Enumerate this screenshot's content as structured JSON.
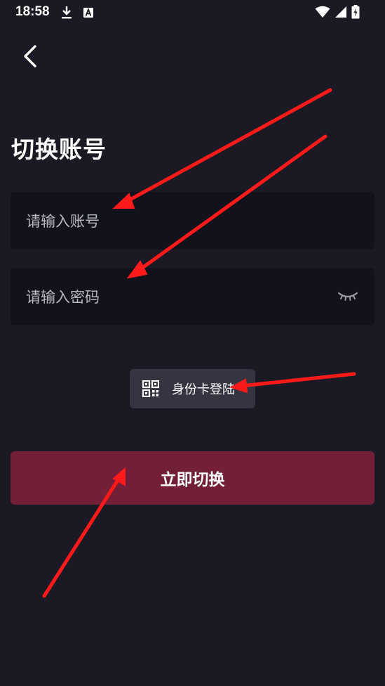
{
  "status_bar": {
    "time": "18:58",
    "icons": [
      "download-icon",
      "a-badge-icon",
      "wifi-icon",
      "signal-icon",
      "battery-charging-icon"
    ]
  },
  "header": {
    "back_icon": "chevron-left-icon",
    "title": "切换账号"
  },
  "form": {
    "account_placeholder": "请输入账号",
    "account_value": "",
    "password_placeholder": "请输入密码",
    "password_value": "",
    "password_toggle_icon": "eye-closed-icon"
  },
  "id_login": {
    "icon": "qr-code-icon",
    "label": "身份卡登陆"
  },
  "submit": {
    "label": "立即切换"
  },
  "colors": {
    "background": "#1b1a24",
    "field_background": "#11121b",
    "secondary_button": "#343541",
    "primary_button": "#731f37",
    "annotation_arrow": "#ff1a1a"
  }
}
